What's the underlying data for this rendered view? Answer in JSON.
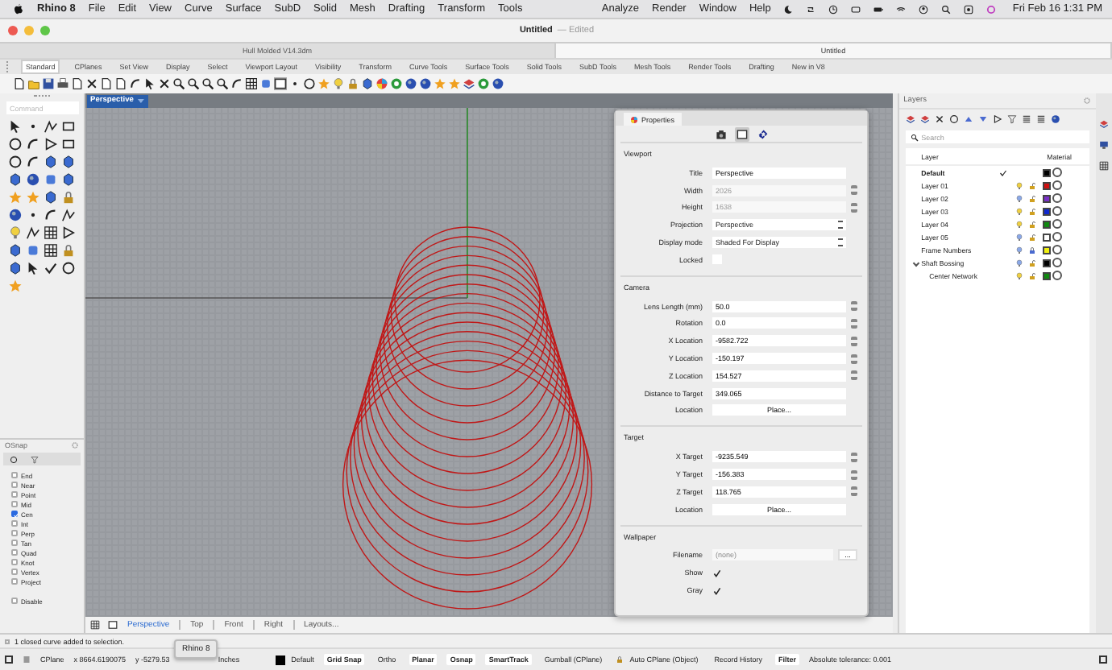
{
  "menubar": {
    "app": "Rhino 8",
    "menus": [
      "File",
      "Edit",
      "View",
      "Curve",
      "Surface",
      "SubD",
      "Solid",
      "Mesh",
      "Drafting",
      "Transform",
      "Tools"
    ],
    "right_menus": [
      "Analyze",
      "Render",
      "Window",
      "Help"
    ],
    "clock": "Fri Feb 16  1:31 PM"
  },
  "window": {
    "title": "Untitled",
    "suffix": "— Edited"
  },
  "document_tabs": [
    {
      "label": "Hull Molded V14.3dm",
      "selected": false
    },
    {
      "label": "Untitled",
      "selected": true
    }
  ],
  "toolbar_tabs": [
    {
      "label": "Standard",
      "selected": true
    },
    {
      "label": "CPlanes",
      "selected": false
    },
    {
      "label": "Set View",
      "selected": false
    },
    {
      "label": "Display",
      "selected": false
    },
    {
      "label": "Select",
      "selected": false
    },
    {
      "label": "Viewport Layout",
      "selected": false
    },
    {
      "label": "Visibility",
      "selected": false
    },
    {
      "label": "Transform",
      "selected": false
    },
    {
      "label": "Curve Tools",
      "selected": false
    },
    {
      "label": "Surface Tools",
      "selected": false
    },
    {
      "label": "Solid Tools",
      "selected": false
    },
    {
      "label": "SubD Tools",
      "selected": false
    },
    {
      "label": "Mesh Tools",
      "selected": false
    },
    {
      "label": "Render Tools",
      "selected": false
    },
    {
      "label": "Drafting",
      "selected": false
    },
    {
      "label": "New in V8",
      "selected": false
    }
  ],
  "command": {
    "placeholder": "Command"
  },
  "osnap": {
    "title": "OSnap",
    "items": [
      {
        "label": "End",
        "checked": false
      },
      {
        "label": "Near",
        "checked": false
      },
      {
        "label": "Point",
        "checked": false
      },
      {
        "label": "Mid",
        "checked": false
      },
      {
        "label": "Cen",
        "checked": true
      },
      {
        "label": "Int",
        "checked": false
      },
      {
        "label": "Perp",
        "checked": false
      },
      {
        "label": "Tan",
        "checked": false
      },
      {
        "label": "Quad",
        "checked": false
      },
      {
        "label": "Knot",
        "checked": false
      },
      {
        "label": "Vertex",
        "checked": false
      },
      {
        "label": "Project",
        "checked": false
      }
    ],
    "disable": {
      "label": "Disable",
      "checked": false
    }
  },
  "viewport": {
    "title": "Perspective",
    "tabs": [
      {
        "label": "Perspective",
        "selected": true
      },
      {
        "label": "Top",
        "selected": false
      },
      {
        "label": "Front",
        "selected": false
      },
      {
        "label": "Right",
        "selected": false
      },
      {
        "label": "Layouts...",
        "selected": false
      }
    ]
  },
  "properties": {
    "tab": "Properties",
    "views": [
      {
        "selected": false
      },
      {
        "selected": true
      },
      {
        "selected": false
      }
    ],
    "sections": [
      {
        "title": "Viewport",
        "fields": [
          {
            "kind": "text",
            "label": "Title",
            "value": "Perspective",
            "disabled": false
          },
          {
            "kind": "spin",
            "label": "Width",
            "value": "2026",
            "disabled": true
          },
          {
            "kind": "spin",
            "label": "Height",
            "value": "1638",
            "disabled": true
          },
          {
            "kind": "select",
            "label": "Projection",
            "value": "Perspective"
          },
          {
            "kind": "select",
            "label": "Display mode",
            "value": "Shaded For Display"
          },
          {
            "kind": "checkbox",
            "label": "Locked",
            "checked": false
          }
        ]
      },
      {
        "title": "Camera",
        "fields": [
          {
            "kind": "spin",
            "label": "Lens Length (mm)",
            "value": "50.0",
            "disabled": false
          },
          {
            "kind": "spin",
            "label": "Rotation",
            "value": "0.0",
            "disabled": false
          },
          {
            "kind": "spin",
            "label": "X Location",
            "value": "-9582.722",
            "disabled": false
          },
          {
            "kind": "spin",
            "label": "Y Location",
            "value": "-150.197",
            "disabled": false
          },
          {
            "kind": "spin",
            "label": "Z Location",
            "value": "154.527",
            "disabled": false
          },
          {
            "kind": "text",
            "label": "Distance to Target",
            "value": "349.065",
            "disabled": false
          },
          {
            "kind": "button",
            "label": "Location",
            "button": "Place..."
          }
        ]
      },
      {
        "title": "Target",
        "fields": [
          {
            "kind": "spin",
            "label": "X Target",
            "value": "-9235.549",
            "disabled": false
          },
          {
            "kind": "spin",
            "label": "Y Target",
            "value": "-156.383",
            "disabled": false
          },
          {
            "kind": "spin",
            "label": "Z Target",
            "value": "118.765",
            "disabled": false
          },
          {
            "kind": "button",
            "label": "Location",
            "button": "Place..."
          }
        ]
      },
      {
        "title": "Wallpaper",
        "fields": [
          {
            "kind": "file",
            "label": "Filename",
            "placeholder": "(none)",
            "button": "..."
          },
          {
            "kind": "checkbox",
            "label": "Show",
            "checked": true
          },
          {
            "kind": "checkbox",
            "label": "Gray",
            "checked": true
          }
        ]
      }
    ]
  },
  "layers": {
    "title": "Layers",
    "search": {
      "placeholder": "Search"
    },
    "columns": [
      "Layer",
      "Material"
    ],
    "rows": [
      {
        "name": "Default",
        "current": true,
        "color": "#000000"
      },
      {
        "name": "Layer 01",
        "current": false,
        "on": true,
        "locked": false,
        "color": "#d01010"
      },
      {
        "name": "Layer 02",
        "current": false,
        "on": false,
        "locked": false,
        "color": "#7a30c8"
      },
      {
        "name": "Layer 03",
        "current": false,
        "on": true,
        "locked": false,
        "color": "#1028d0"
      },
      {
        "name": "Layer 04",
        "current": false,
        "on": true,
        "locked": false,
        "color": "#108a10"
      },
      {
        "name": "Layer 05",
        "current": false,
        "on": false,
        "locked": false,
        "color": "#ffffff"
      },
      {
        "name": "Frame Numbers",
        "current": false,
        "on": false,
        "locked": true,
        "color": "#f0f010"
      },
      {
        "name": "Shaft Bossing",
        "current": false,
        "on": false,
        "locked": false,
        "color": "#000000",
        "expanded": true,
        "children": [
          {
            "name": "Center Network",
            "current": false,
            "on": true,
            "locked": false,
            "color": "#108a10"
          }
        ]
      }
    ]
  },
  "status_message": "1 closed curve added to selection.",
  "status_bar": {
    "cplane": "CPlane",
    "x": "x 8664.6190075",
    "y": "y -5279.53",
    "tooltip": "Rhino 8",
    "units": "Inches",
    "layer": {
      "name": "Default",
      "color": "#000000"
    },
    "toggles": [
      {
        "label": "Grid Snap",
        "on": true
      },
      {
        "label": "Ortho",
        "on": false
      },
      {
        "label": "Planar",
        "on": true
      },
      {
        "label": "Osnap",
        "on": true
      },
      {
        "label": "SmartTrack",
        "on": true
      },
      {
        "label": "Gumball (CPlane)",
        "on": false
      },
      {
        "label": "Auto CPlane (Object)",
        "on": false,
        "lock": true
      },
      {
        "label": "Record History",
        "on": false
      },
      {
        "label": "Filter",
        "on": true
      }
    ],
    "tolerance": "Absolute tolerance: 0.001"
  }
}
